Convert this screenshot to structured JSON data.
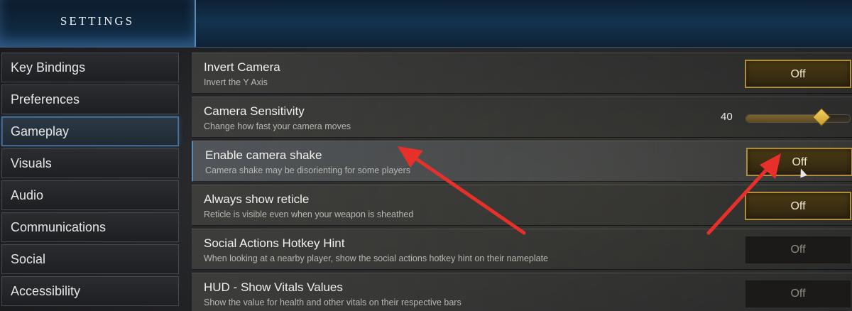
{
  "header": {
    "title": "SETTINGS"
  },
  "sidebar": {
    "items": [
      {
        "label": "Key Bindings"
      },
      {
        "label": "Preferences"
      },
      {
        "label": "Gameplay"
      },
      {
        "label": "Visuals"
      },
      {
        "label": "Audio"
      },
      {
        "label": "Communications"
      },
      {
        "label": "Social"
      },
      {
        "label": "Accessibility"
      }
    ]
  },
  "settings": [
    {
      "title": "Invert Camera",
      "desc": "Invert the Y Axis",
      "control": "toggle",
      "value": "Off"
    },
    {
      "title": "Camera Sensitivity",
      "desc": "Change how fast your camera moves",
      "control": "slider",
      "value": "40",
      "level": 0.72
    },
    {
      "title": "Enable camera shake",
      "desc": "Camera shake may be disorienting for some players",
      "control": "toggle",
      "value": "Off"
    },
    {
      "title": "Always show reticle",
      "desc": "Reticle is visible even when your weapon is sheathed",
      "control": "toggle",
      "value": "Off"
    },
    {
      "title": "Social Actions Hotkey Hint",
      "desc": "When looking at a nearby player, show the social actions hotkey hint on their nameplate",
      "control": "toggle",
      "value": "Off"
    },
    {
      "title": "HUD - Show Vitals Values",
      "desc": "Show the value for health and other vitals on their respective bars",
      "control": "toggle",
      "value": "Off"
    }
  ],
  "colors": {
    "accent_gold": "#b08d3a",
    "selection_blue": "#5a8bb4",
    "annotation_red": "#e8302a"
  }
}
